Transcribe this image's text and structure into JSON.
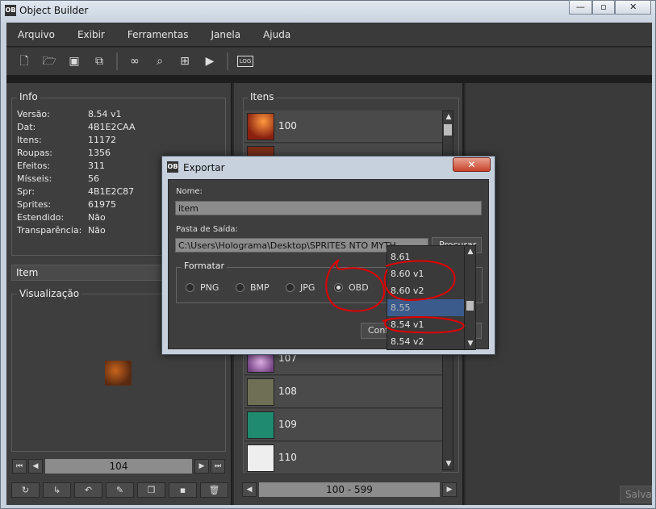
{
  "window": {
    "title": "Object Builder",
    "icon": "app-logo-icon",
    "controls": [
      "—",
      "▫",
      "✕"
    ]
  },
  "menu": [
    "Arquivo",
    "Exibir",
    "Ferramentas",
    "Janela",
    "Ajuda"
  ],
  "toolbar": [
    "new-file-icon",
    "open-folder-icon",
    "save-icon",
    "save-as-icon",
    "binoculars-icon",
    "search-icon",
    "grid-icon",
    "play-icon",
    "log-icon"
  ],
  "info": {
    "title": "Info",
    "rows": [
      {
        "k": "Versão:",
        "v": "8.54 v1"
      },
      {
        "k": "Dat:",
        "v": "4B1E2CAA"
      },
      {
        "k": "Itens:",
        "v": "11172"
      },
      {
        "k": "Roupas:",
        "v": "1356"
      },
      {
        "k": "Efeitos:",
        "v": "311"
      },
      {
        "k": "Mísseis:",
        "v": "56"
      },
      {
        "k": "Spr:",
        "v": "4B1E2C87"
      },
      {
        "k": "Sprites:",
        "v": "61975"
      },
      {
        "k": "Estendido:",
        "v": "Não"
      },
      {
        "k": "Transparência:",
        "v": "Não"
      }
    ]
  },
  "item_section": "Item",
  "preview_title": "Visualização",
  "item_number": "104",
  "items_panel": {
    "title": "Itens",
    "rows": [
      {
        "id": "100",
        "color": "#b4451a"
      },
      {
        "id": "107",
        "color": "#c8a0d0"
      },
      {
        "id": "108",
        "color": "#6f6f55"
      },
      {
        "id": "109",
        "color": "#1f8a6e"
      },
      {
        "id": "110",
        "color": "#d9d9d9"
      }
    ],
    "range": "100 - 599"
  },
  "right_button": "Salvar",
  "dialog": {
    "title": "Exportar",
    "close": "✕",
    "name_label": "Nome:",
    "name_value": "item",
    "output_label": "Pasta de Saída:",
    "output_value": "C:\\Users\\Holograma\\Desktop\\SPRITES NTO MYTH",
    "browse": "Procurar",
    "format_label": "Formatar",
    "formats": [
      "PNG",
      "BMP",
      "JPG",
      "OBD"
    ],
    "selected_format": "OBD",
    "confirm": "Confirmar"
  },
  "dropdown": {
    "items": [
      "8.61",
      "8.60 v1",
      "8.60 v2",
      "8.55",
      "8.54 v1",
      "8.54 v2"
    ],
    "highlighted": "8.55"
  },
  "colors": {
    "annotation": "#e00000"
  }
}
